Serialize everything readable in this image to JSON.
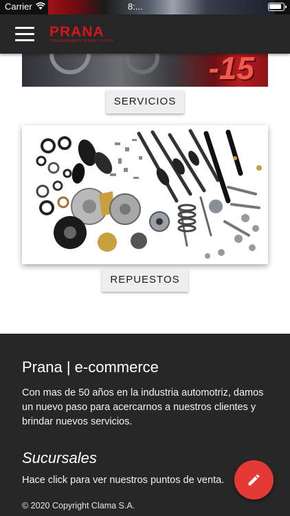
{
  "status_bar": {
    "carrier": "Carrier",
    "time": "8:..."
  },
  "header": {
    "brand": "PRANA",
    "tagline": "CONCESIONARIO OFICIAL TOYOTA"
  },
  "promo": {
    "discount_text": "-15"
  },
  "sections": {
    "services_label": "SERVICIOS",
    "parts_label": "REPUESTOS"
  },
  "footer": {
    "title": "Prana | e-commerce",
    "description": "Con mas de 50 años en la industria automotriz, damos un nuevo paso para acercarnos a nuestros clientes y brindar nuevos servicios.",
    "branches_title": "Sucursales",
    "branches_link": "Hace click para ver nuestros puntos de venta.",
    "copyright": "© 2020 Copyright Clama S.A."
  },
  "icons": {
    "menu": "menu-icon",
    "fab": "pencil-icon",
    "wifi": "wifi-icon",
    "battery": "battery-icon"
  },
  "colors": {
    "brand_red": "#d8141c",
    "header_bg": "#262626",
    "footer_bg": "#272727",
    "fab_bg": "#e53935",
    "button_bg": "#eeeeee"
  }
}
